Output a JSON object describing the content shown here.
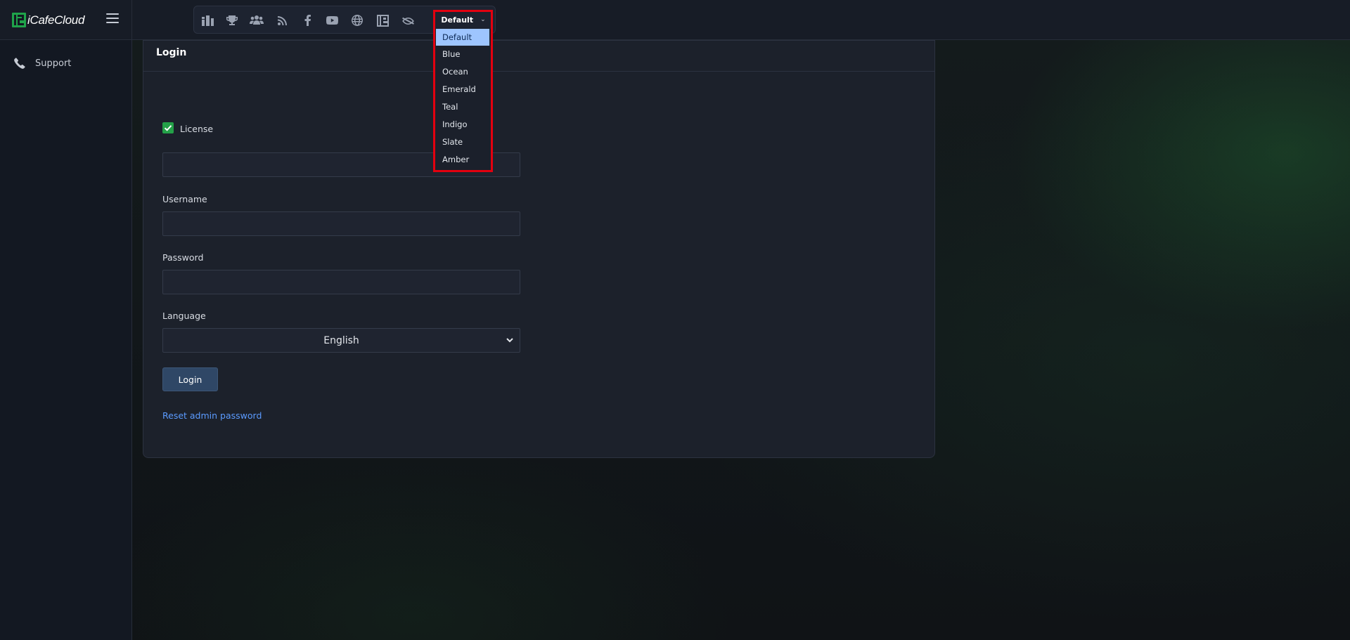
{
  "app": {
    "brand": "iCafeCloud"
  },
  "sidebar": {
    "items": [
      {
        "label": "Support",
        "icon": "phone-icon"
      }
    ]
  },
  "toolbar": {
    "icons": [
      "dashboard-icon",
      "trophy-icon",
      "users-icon",
      "rss-icon",
      "facebook-icon",
      "youtube-icon",
      "globe-icon",
      "icafe-logo-icon",
      "eye-slash-icon"
    ],
    "theme_select": {
      "value": "Default",
      "options": [
        "Default",
        "Blue",
        "Ocean",
        "Emerald",
        "Teal",
        "Indigo",
        "Slate",
        "Amber"
      ]
    }
  },
  "login": {
    "title": "Login",
    "license_label": "License",
    "license_checked": true,
    "license_value": "",
    "username_label": "Username",
    "username_value": "",
    "password_label": "Password",
    "password_value": "",
    "language_label": "Language",
    "language_value": "English",
    "submit_label": "Login",
    "reset_link": "Reset admin password"
  },
  "colors": {
    "accent_green": "#24a148",
    "link_blue": "#5b9bff",
    "highlight_red": "#e3000f",
    "selected_option": "#9ec5fe",
    "button": "#2f4766"
  }
}
